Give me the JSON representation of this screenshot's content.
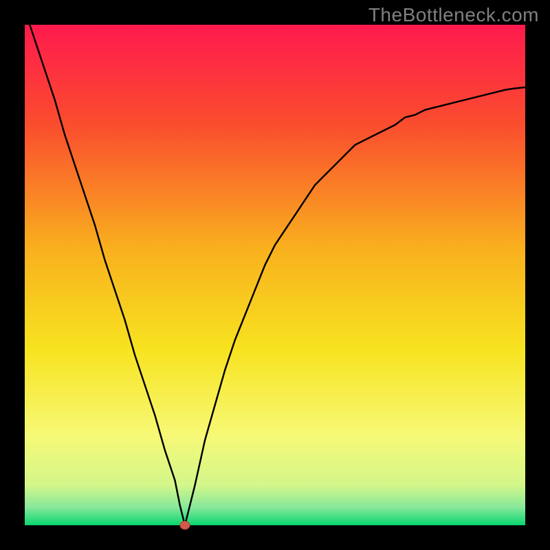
{
  "watermark": "TheBottleneck.com",
  "chart_data": {
    "type": "line",
    "title": "",
    "xlabel": "",
    "ylabel": "",
    "xlim": [
      0,
      100
    ],
    "ylim": [
      0,
      100
    ],
    "x": [
      0,
      2,
      4,
      6,
      8,
      10,
      12,
      14,
      16,
      18,
      20,
      22,
      24,
      26,
      28,
      30,
      31,
      32,
      33,
      34,
      36,
      38,
      40,
      42,
      44,
      46,
      48,
      50,
      52,
      54,
      56,
      58,
      60,
      62,
      64,
      66,
      68,
      70,
      72,
      74,
      76,
      78,
      80,
      82,
      84,
      86,
      88,
      90,
      92,
      94,
      96,
      98,
      100
    ],
    "values": [
      103,
      97,
      91,
      85,
      78,
      72,
      66,
      60,
      53,
      47,
      41,
      34,
      28,
      22,
      15,
      9,
      4,
      0,
      4,
      8,
      17,
      24,
      31,
      37,
      42,
      47,
      52,
      56,
      59,
      62,
      65,
      68,
      70,
      72,
      74,
      76,
      77,
      78,
      79,
      80,
      81.5,
      82,
      83,
      83.5,
      84,
      84.5,
      85,
      85.5,
      86,
      86.5,
      87,
      87.3,
      87.5
    ],
    "optimal_point": {
      "x": 32,
      "y": 0
    },
    "background": {
      "type": "vertical-gradient",
      "stops": [
        {
          "pos": 0.0,
          "color": "#ff1a4d"
        },
        {
          "pos": 0.2,
          "color": "#fa4d2e"
        },
        {
          "pos": 0.45,
          "color": "#f9b11e"
        },
        {
          "pos": 0.65,
          "color": "#f7e320"
        },
        {
          "pos": 0.82,
          "color": "#f7f976"
        },
        {
          "pos": 0.92,
          "color": "#d3f68a"
        },
        {
          "pos": 0.965,
          "color": "#86e89a"
        },
        {
          "pos": 1.0,
          "color": "#08d670"
        }
      ]
    }
  }
}
